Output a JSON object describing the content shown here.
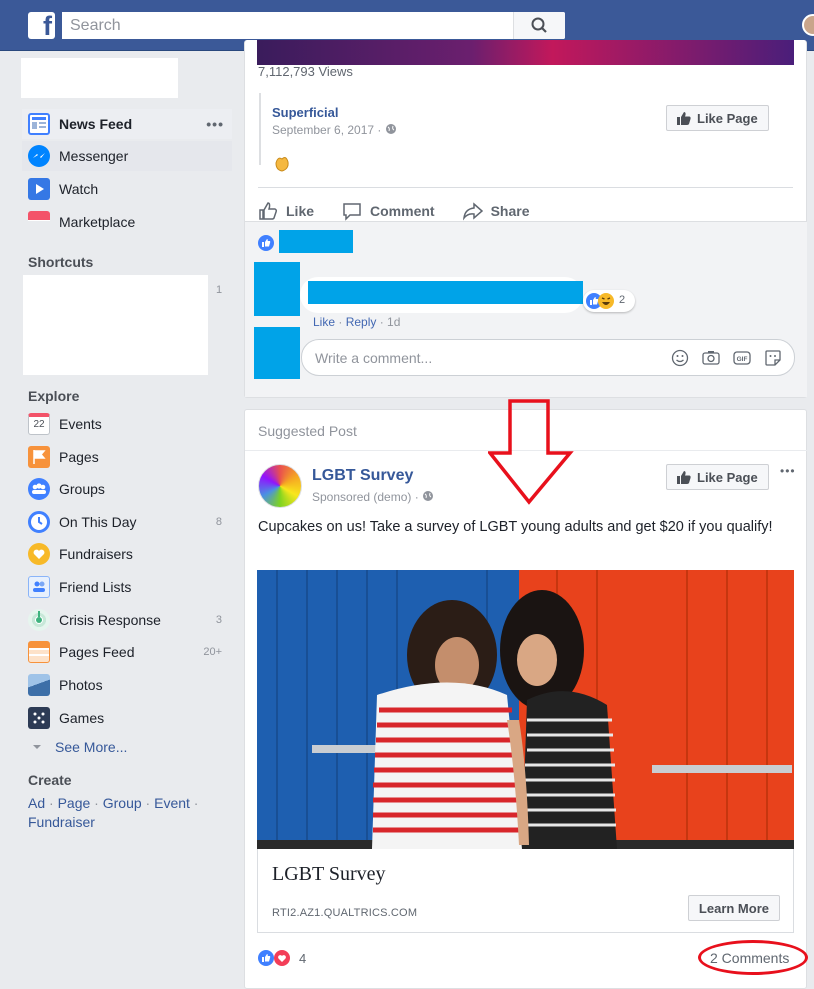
{
  "topbar": {
    "logo": "f",
    "search_placeholder": "Search",
    "icons": [
      "facebook-logo",
      "search-icon"
    ]
  },
  "sidebar": {
    "main_items": [
      {
        "label": "News Feed",
        "icon": "news-feed-icon",
        "more": "•••"
      },
      {
        "label": "Messenger",
        "icon": "messenger-icon"
      },
      {
        "label": "Watch",
        "icon": "watch-icon"
      },
      {
        "label": "Marketplace",
        "icon": "marketplace-icon"
      }
    ],
    "shortcuts_title": "Shortcuts",
    "shortcuts_count": "1",
    "explore_title": "Explore",
    "explore_items": [
      {
        "label": "Events",
        "icon": "events-icon",
        "count": "",
        "glyph": "22"
      },
      {
        "label": "Pages",
        "icon": "pages-icon",
        "count": ""
      },
      {
        "label": "Groups",
        "icon": "groups-icon",
        "count": ""
      },
      {
        "label": "On This Day",
        "icon": "on-this-day-icon",
        "count": "8"
      },
      {
        "label": "Fundraisers",
        "icon": "fundraisers-icon",
        "count": ""
      },
      {
        "label": "Friend Lists",
        "icon": "friend-lists-icon",
        "count": ""
      },
      {
        "label": "Crisis Response",
        "icon": "crisis-response-icon",
        "count": "3"
      },
      {
        "label": "Pages Feed",
        "icon": "pages-feed-icon",
        "count": "20+"
      },
      {
        "label": "Photos",
        "icon": "photos-icon",
        "count": ""
      },
      {
        "label": "Games",
        "icon": "games-icon",
        "count": ""
      }
    ],
    "see_more": "See More...",
    "create_title": "Create",
    "create_links": [
      "Ad",
      "Page",
      "Group",
      "Event",
      "Fundraiser"
    ]
  },
  "post1": {
    "views": "7,112,793 Views",
    "page_name": "Superficial",
    "date": "September 6, 2017 · ",
    "like_page": "Like Page",
    "actions": {
      "like": "Like",
      "comment": "Comment",
      "share": "Share"
    },
    "comment": {
      "reactions_count": "2",
      "like": "Like",
      "reply": "Reply",
      "sep": " · ",
      "age": "1d"
    },
    "write_placeholder": "Write a comment..."
  },
  "post2": {
    "label": "Suggested Post",
    "page_name": "LGBT Survey",
    "sponsored": "Sponsored (demo) · ",
    "like_page": "Like Page",
    "more": "•••",
    "text": "Cupcakes on us! Take a survey of LGBT young adults and get $20 if you qualify!",
    "ad_title": "LGBT Survey",
    "ad_domain": "RTI2.AZ1.QUALTRICS.COM",
    "learn_more": "Learn More",
    "reactions_count": "4",
    "comments_count": "2 Comments"
  },
  "colors": {
    "brand": "#3b5998",
    "link": "#365899",
    "redacted": "#00a3e8",
    "annotation": "#e8101c"
  }
}
